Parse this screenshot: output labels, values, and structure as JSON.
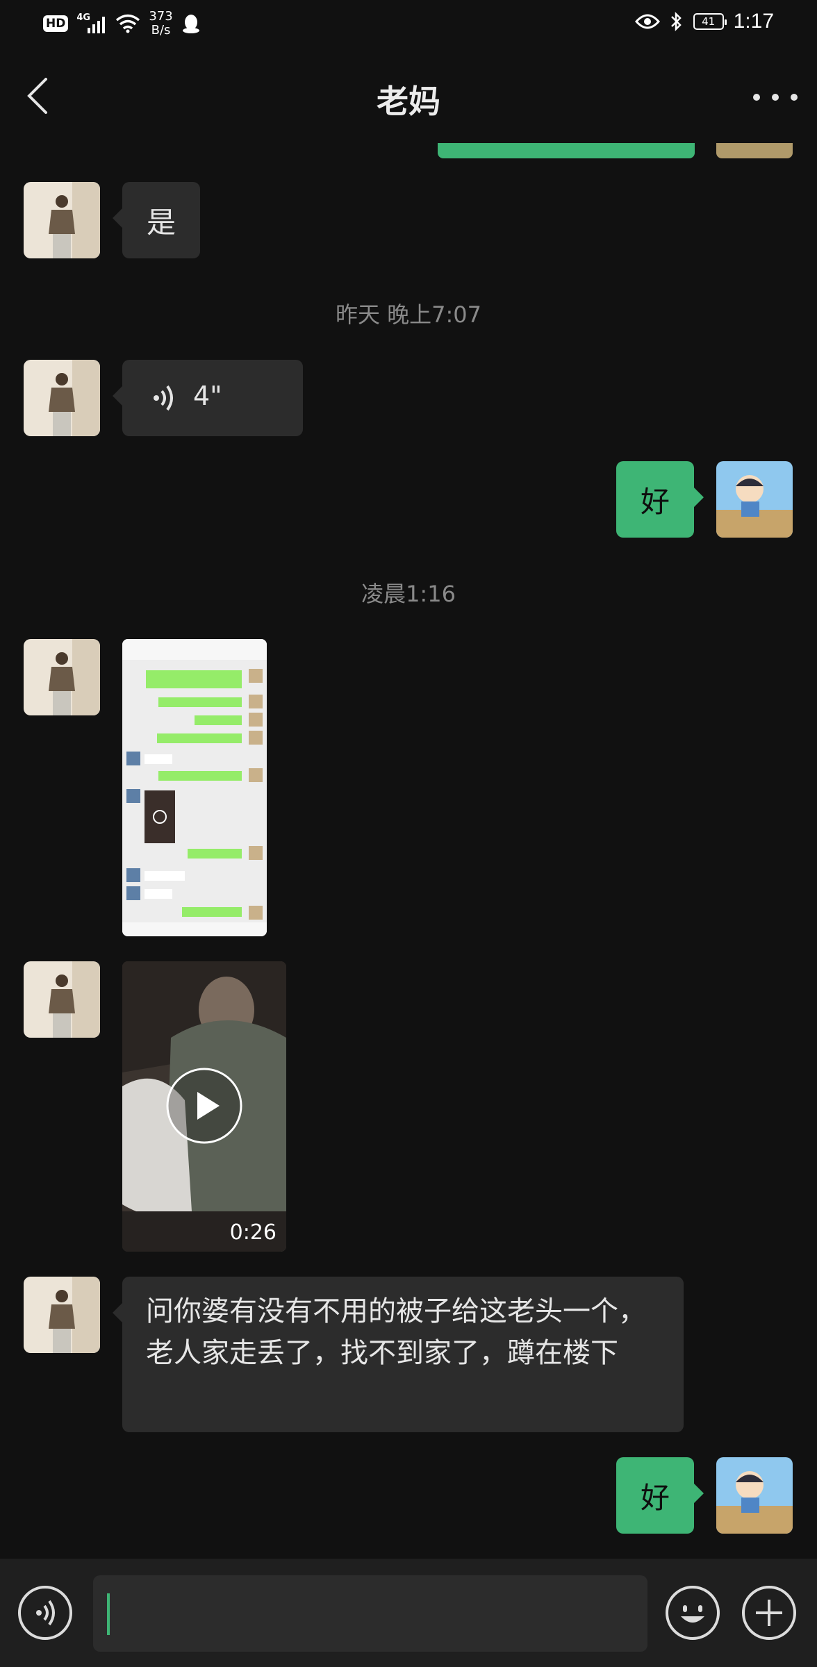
{
  "status_bar": {
    "hd": "HD",
    "network": "4G",
    "net_speed_value": "373",
    "net_speed_unit": "B/s",
    "battery": "41",
    "time": "1:17"
  },
  "header": {
    "title": "老妈"
  },
  "messages": {
    "m1_text": "是",
    "ts1": "昨天 晚上7:07",
    "voice_duration": "4\"",
    "reply1": "好",
    "ts2": "凌晨1:16",
    "video_duration": "0:26",
    "m_long": "问你婆有没有不用的被子给这老头一个，老人家走丢了，找不到家了，蹲在楼下",
    "reply2": "好"
  },
  "colors": {
    "accent_green": "#3eb575",
    "bubble_gray": "#2c2c2c",
    "background": "#111111"
  }
}
